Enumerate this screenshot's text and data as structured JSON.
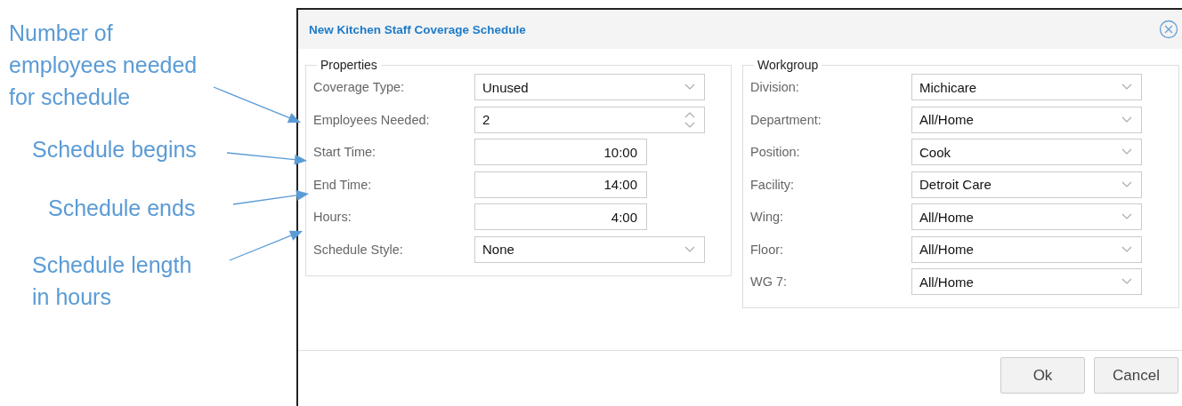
{
  "annotations": [
    {
      "text": "Number of\nemployees needed\nfor schedule"
    },
    {
      "text": "Schedule begins"
    },
    {
      "text": "Schedule ends"
    },
    {
      "text": "Schedule length\nin hours"
    }
  ],
  "dialog": {
    "title": "New Kitchen Staff Coverage Schedule",
    "groups": [
      {
        "legend": "Properties",
        "fields": [
          {
            "label": "Coverage Type:",
            "kind": "select",
            "value": "Unused"
          },
          {
            "label": "Employees Needed:",
            "kind": "number",
            "value": "2"
          },
          {
            "label": "Start Time:",
            "kind": "time",
            "value": "10:00"
          },
          {
            "label": "End Time:",
            "kind": "time",
            "value": "14:00"
          },
          {
            "label": "Hours:",
            "kind": "time",
            "value": "4:00"
          },
          {
            "label": "Schedule Style:",
            "kind": "select",
            "value": "None"
          }
        ]
      },
      {
        "legend": "Workgroup",
        "fields": [
          {
            "label": "Division:",
            "kind": "select",
            "value": "Michicare"
          },
          {
            "label": "Department:",
            "kind": "select",
            "value": "All/Home"
          },
          {
            "label": "Position:",
            "kind": "select",
            "value": "Cook"
          },
          {
            "label": "Facility:",
            "kind": "select",
            "value": "Detroit Care"
          },
          {
            "label": "Wing:",
            "kind": "select",
            "value": "All/Home"
          },
          {
            "label": "Floor:",
            "kind": "select",
            "value": "All/Home"
          },
          {
            "label": "WG 7:",
            "kind": "select",
            "value": "All/Home"
          }
        ]
      }
    ],
    "buttons": [
      "Ok",
      "Cancel"
    ]
  }
}
